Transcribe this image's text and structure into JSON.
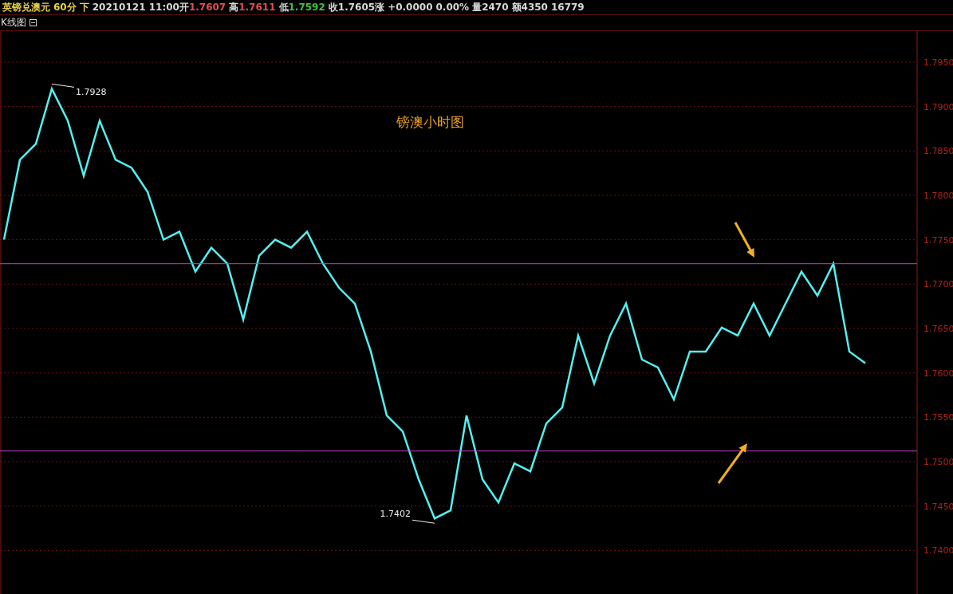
{
  "header": [
    {
      "text": "英镑兑澳元",
      "color": "#e8d24a"
    },
    {
      "text": "60分",
      "color": "#e8d24a"
    },
    {
      "text": "下",
      "color": "#e8d24a"
    },
    {
      "text": "20210121 11:00开",
      "color": "#d8d8d8"
    },
    {
      "text": "1.7607",
      "color": "#e05050"
    },
    {
      "text": "高",
      "color": "#d8d8d8"
    },
    {
      "text": "1.7611",
      "color": "#e05050"
    },
    {
      "text": "低",
      "color": "#d8d8d8"
    },
    {
      "text": "1.7592",
      "color": "#40c040"
    },
    {
      "text": "收1.7605",
      "color": "#d8d8d8"
    },
    {
      "text": "涨",
      "color": "#d8d8d8"
    },
    {
      "text": "+0.0000",
      "color": "#d8d8d8"
    },
    {
      "text": "0.00%",
      "color": "#d8d8d8"
    },
    {
      "text": "量2470",
      "color": "#d8d8d8"
    },
    {
      "text": "额4350",
      "color": "#d8d8d8"
    },
    {
      "text": "16779",
      "color": "#d8d8d8"
    }
  ],
  "panel": {
    "title": "K线图",
    "collapsed": false
  },
  "chart_data": {
    "type": "line",
    "title": "镑澳小时图",
    "ylim": [
      1.735,
      1.7985
    ],
    "grid": true,
    "yticks": [
      {
        "value": 1.795,
        "label": "1.7950"
      },
      {
        "value": 1.79,
        "label": "1.7900"
      },
      {
        "value": 1.785,
        "label": "1.7850"
      },
      {
        "value": 1.78,
        "label": "1.7800"
      },
      {
        "value": 1.775,
        "label": "1.7750"
      },
      {
        "value": 1.77,
        "label": "1.7700"
      },
      {
        "value": 1.765,
        "label": "1.7650"
      },
      {
        "value": 1.76,
        "label": "1.7600"
      },
      {
        "value": 1.755,
        "label": "1.7550"
      },
      {
        "value": 1.75,
        "label": "1.7500"
      },
      {
        "value": 1.745,
        "label": "1.7450"
      },
      {
        "value": 1.74,
        "label": "1.7400"
      }
    ],
    "series": [
      {
        "color": "#54f0f0",
        "values": [
          1.775,
          1.784,
          1.7858,
          1.792,
          1.7884,
          1.7822,
          1.7884,
          1.784,
          1.7831,
          1.7804,
          1.775,
          1.7759,
          1.7714,
          1.7741,
          1.7723,
          1.766,
          1.7732,
          1.775,
          1.7741,
          1.7759,
          1.7723,
          1.7696,
          1.7678,
          1.7624,
          1.7552,
          1.7534,
          1.748,
          1.7436,
          1.7445,
          1.7552,
          1.748,
          1.7454,
          1.7498,
          1.7489,
          1.7543,
          1.7561,
          1.7642,
          1.7588,
          1.7642,
          1.7678,
          1.7615,
          1.7606,
          1.757,
          1.7624,
          1.7624,
          1.7651,
          1.7642,
          1.7678,
          1.7642,
          1.7678,
          1.7714,
          1.7687,
          1.7723,
          1.7624,
          1.7611
        ]
      }
    ],
    "ref_lines": [
      {
        "axis": "y",
        "value": 1.7723,
        "color": "#c040c0"
      },
      {
        "axis": "y",
        "value": 1.7512,
        "color": "#c040c0"
      }
    ],
    "annotations": [
      "1.7928",
      "1.7402"
    ]
  }
}
